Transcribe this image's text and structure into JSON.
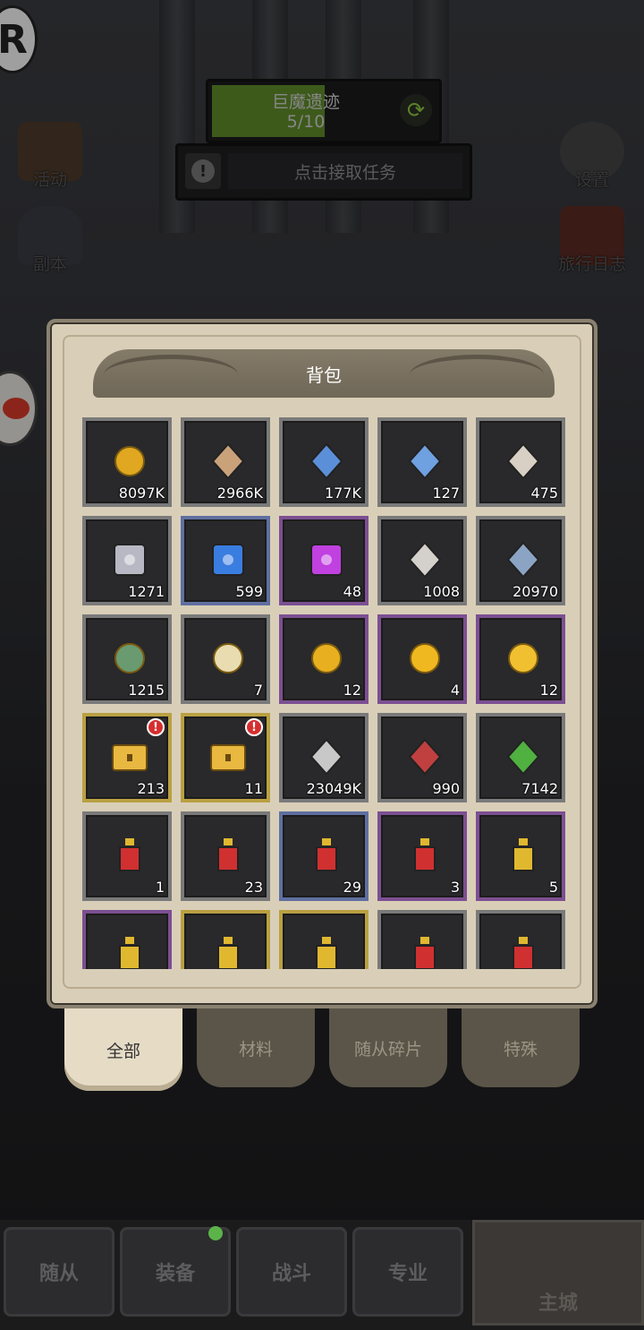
{
  "hud": {
    "avatar_letter": "R",
    "quest": {
      "title": "巨魔遗迹",
      "progress": "5/10",
      "progress_fraction": 0.5
    },
    "task_label": "点击接取任务",
    "left_buttons": [
      {
        "label": "活动"
      },
      {
        "label": "副本"
      }
    ],
    "right_buttons": [
      {
        "label": "设置"
      },
      {
        "label": "旅行日志"
      }
    ]
  },
  "backpack": {
    "title": "背包",
    "items": [
      {
        "count": "8097K",
        "rarity": "gray",
        "icon": "gold-coin-icon",
        "color": "#e0a820"
      },
      {
        "count": "2966K",
        "rarity": "gray",
        "icon": "wood-log-icon",
        "color": "#c9a27a"
      },
      {
        "count": "177K",
        "rarity": "gray",
        "icon": "blue-rune-stone-icon",
        "color": "#5b8fd8"
      },
      {
        "count": "127",
        "rarity": "gray",
        "icon": "crystal-shard-icon",
        "color": "#6fa0e0"
      },
      {
        "count": "475",
        "rarity": "gray",
        "icon": "scroll-icon",
        "color": "#d8d0c4"
      },
      {
        "count": "1271",
        "rarity": "gray",
        "icon": "gray-puzzle-icon",
        "color": "#b8b8c4"
      },
      {
        "count": "599",
        "rarity": "blue",
        "icon": "blue-puzzle-icon",
        "color": "#3a7de0"
      },
      {
        "count": "48",
        "rarity": "purple",
        "icon": "purple-puzzle-icon",
        "color": "#c040e0"
      },
      {
        "count": "1008",
        "rarity": "gray",
        "icon": "rune-stone-icon",
        "color": "#d4d0cc"
      },
      {
        "count": "20970",
        "rarity": "gray",
        "icon": "ore-icon",
        "color": "#8ca4c4"
      },
      {
        "count": "1215",
        "rarity": "gray",
        "icon": "jade-coin-icon",
        "color": "#6a9a70"
      },
      {
        "count": "7",
        "rarity": "gray",
        "icon": "ring-stone-icon",
        "color": "#e8dcb0"
      },
      {
        "count": "12",
        "rarity": "purple",
        "icon": "star-badge-icon",
        "color": "#e8b020"
      },
      {
        "count": "4",
        "rarity": "purple",
        "icon": "gold-ingot-icon",
        "color": "#f0b820"
      },
      {
        "count": "12",
        "rarity": "purple",
        "icon": "gold-mushroom-icon",
        "color": "#f0c030"
      },
      {
        "count": "213",
        "rarity": "gold",
        "icon": "treasure-chest-icon",
        "color": "#e8b840",
        "alert": "!"
      },
      {
        "count": "11",
        "rarity": "gold",
        "icon": "treasure-chest-icon",
        "color": "#e8b840",
        "alert": "!"
      },
      {
        "count": "23049K",
        "rarity": "gray",
        "icon": "crossed-swords-icon",
        "color": "#c8c8c8"
      },
      {
        "count": "990",
        "rarity": "gray",
        "icon": "trophy-icon",
        "color": "#c04040"
      },
      {
        "count": "7142",
        "rarity": "gray",
        "icon": "clover-icon",
        "color": "#50b040"
      },
      {
        "count": "1",
        "rarity": "gray",
        "icon": "red-potion-icon",
        "color": "#d03030"
      },
      {
        "count": "23",
        "rarity": "gray",
        "icon": "red-potion-icon",
        "color": "#d03030"
      },
      {
        "count": "29",
        "rarity": "blue",
        "icon": "red-flask-icon",
        "color": "#d03030"
      },
      {
        "count": "3",
        "rarity": "purple",
        "icon": "red-bottle-icon",
        "color": "#d03030"
      },
      {
        "count": "5",
        "rarity": "purple",
        "icon": "gold-potion-icon",
        "color": "#e0b830"
      },
      {
        "count": "",
        "rarity": "purple",
        "icon": "gold-flask-icon",
        "color": "#e0b830"
      },
      {
        "count": "",
        "rarity": "gold",
        "icon": "gold-bottle-icon",
        "color": "#e0b830"
      },
      {
        "count": "",
        "rarity": "gold",
        "icon": "gold-lantern-icon",
        "color": "#e0b830"
      },
      {
        "count": "",
        "rarity": "gray",
        "icon": "red-potion-icon",
        "color": "#d03030"
      },
      {
        "count": "",
        "rarity": "gray",
        "icon": "red-potion-icon",
        "color": "#d03030"
      }
    ],
    "tabs": [
      {
        "label": "全部",
        "active": true
      },
      {
        "label": "材料",
        "active": false
      },
      {
        "label": "随从碎片",
        "active": false
      },
      {
        "label": "特殊",
        "active": false
      }
    ]
  },
  "bottom_nav": [
    {
      "label": "随从"
    },
    {
      "label": "装备",
      "dot": true
    },
    {
      "label": "战斗"
    },
    {
      "label": "专业"
    },
    {
      "label": "主城"
    }
  ],
  "colors": {
    "gray": "#7a7a7a",
    "blue": "#5f6fa0",
    "purple": "#7c4f92",
    "gold": "#b9a042"
  }
}
